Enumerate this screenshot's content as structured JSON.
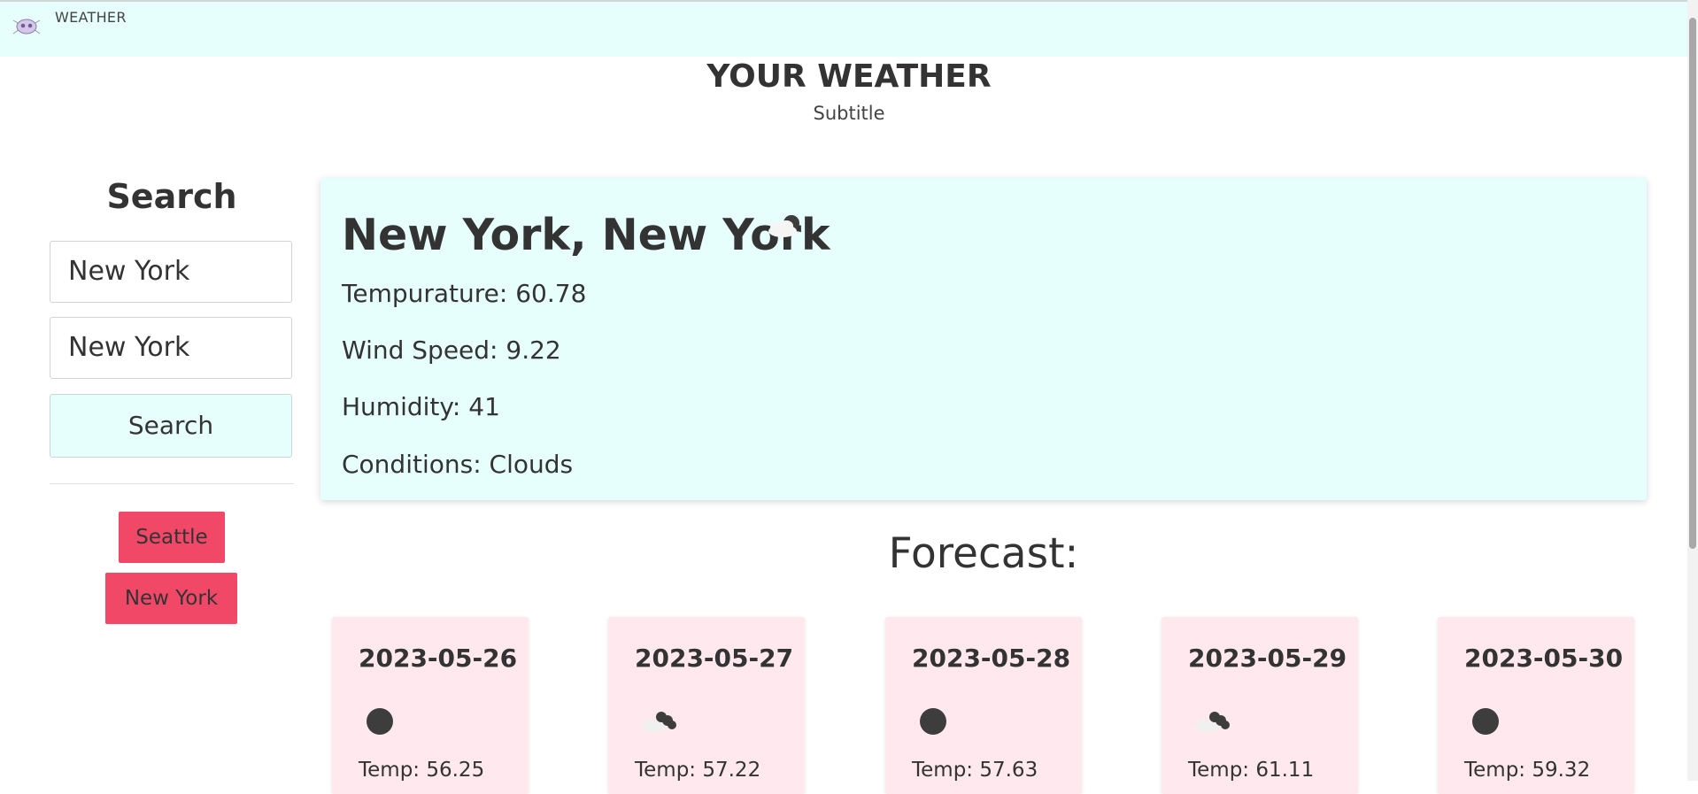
{
  "navbar": {
    "brand": "WEATHER"
  },
  "header": {
    "title": "YOUR WEATHER",
    "subtitle": "Subtitle"
  },
  "search": {
    "heading": "Search",
    "city_value": "New York",
    "state_value": "New York",
    "button_label": "Search"
  },
  "history": [
    {
      "label": "Seattle"
    },
    {
      "label": "New York"
    }
  ],
  "current": {
    "location": "New York, New York",
    "icon": "partly-cloudy-icon",
    "temperature": "Tempurature: 60.78",
    "wind": "Wind Speed: 9.22",
    "humidity": "Humidity: 41",
    "conditions": "Conditions: Clouds"
  },
  "forecast": {
    "heading": "Forecast:",
    "days": [
      {
        "date": "2023-05-26",
        "icon": "dark-cloud-icon",
        "temp": "Temp: 56.25"
      },
      {
        "date": "2023-05-27",
        "icon": "broken-clouds-icon",
        "temp": "Temp: 57.22"
      },
      {
        "date": "2023-05-28",
        "icon": "dark-cloud-icon",
        "temp": "Temp: 57.63"
      },
      {
        "date": "2023-05-29",
        "icon": "broken-clouds-icon",
        "temp": "Temp: 61.11"
      },
      {
        "date": "2023-05-30",
        "icon": "dark-cloud-icon",
        "temp": "Temp: 59.32"
      }
    ]
  },
  "colors": {
    "navbar_bg": "#e6fffc",
    "card_bg": "#e6fffc",
    "forecast_card_bg": "#ffe9ee",
    "history_button": "#f24868"
  }
}
